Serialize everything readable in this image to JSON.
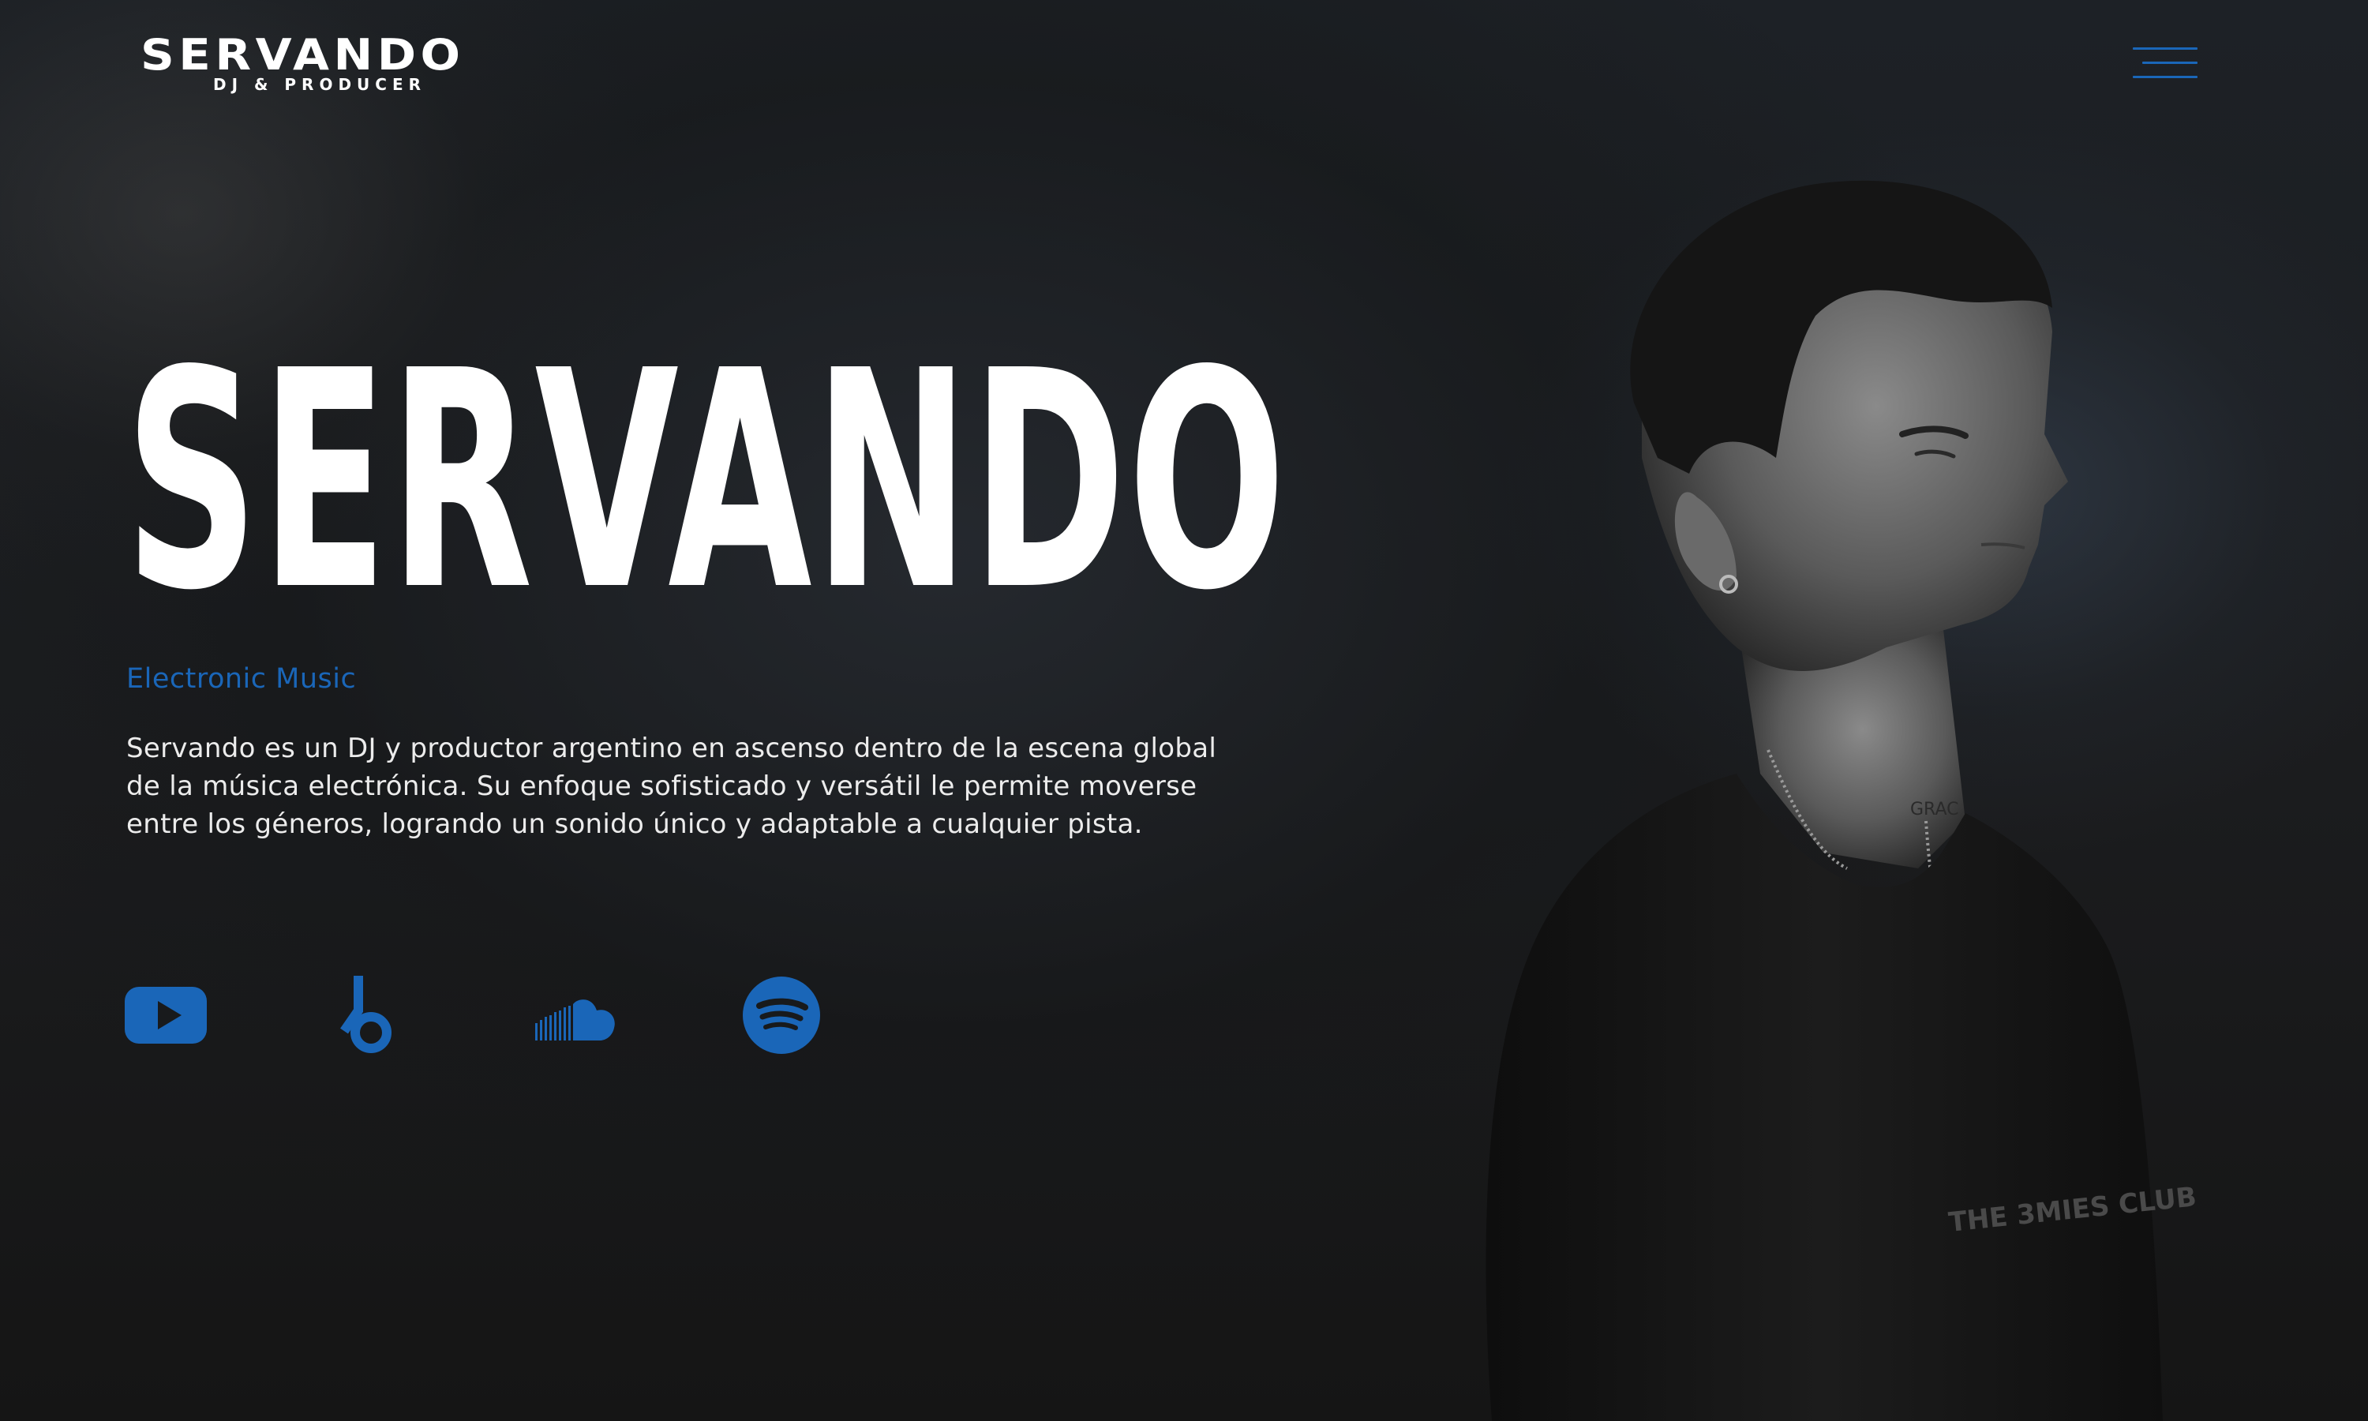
{
  "header": {
    "logo_text": "SERVANDO",
    "logo_subtitle": "DJ & PRODUCER",
    "menu_icon": "hamburger-menu-icon"
  },
  "hero": {
    "title": "SERVANDO",
    "tagline": "Electronic Music",
    "bio": "Servando es un DJ y productor argentino en ascenso dentro de la escena global de la música electrónica. Su enfoque sofisticado y versátil le permite moverse entre los géneros, logrando un sonido único y adaptable a cualquier pista."
  },
  "social_links": [
    {
      "name": "youtube",
      "icon": "youtube-icon"
    },
    {
      "name": "beatport",
      "icon": "beatport-icon"
    },
    {
      "name": "soundcloud",
      "icon": "soundcloud-icon"
    },
    {
      "name": "spotify",
      "icon": "spotify-icon"
    }
  ],
  "portrait": {
    "shirt_print": "THE 3MIES CLUB",
    "neck_tattoo": "GRAC"
  },
  "colors": {
    "accent": "#1a66b8",
    "background": "#1b1c1e",
    "text": "#ffffff"
  }
}
